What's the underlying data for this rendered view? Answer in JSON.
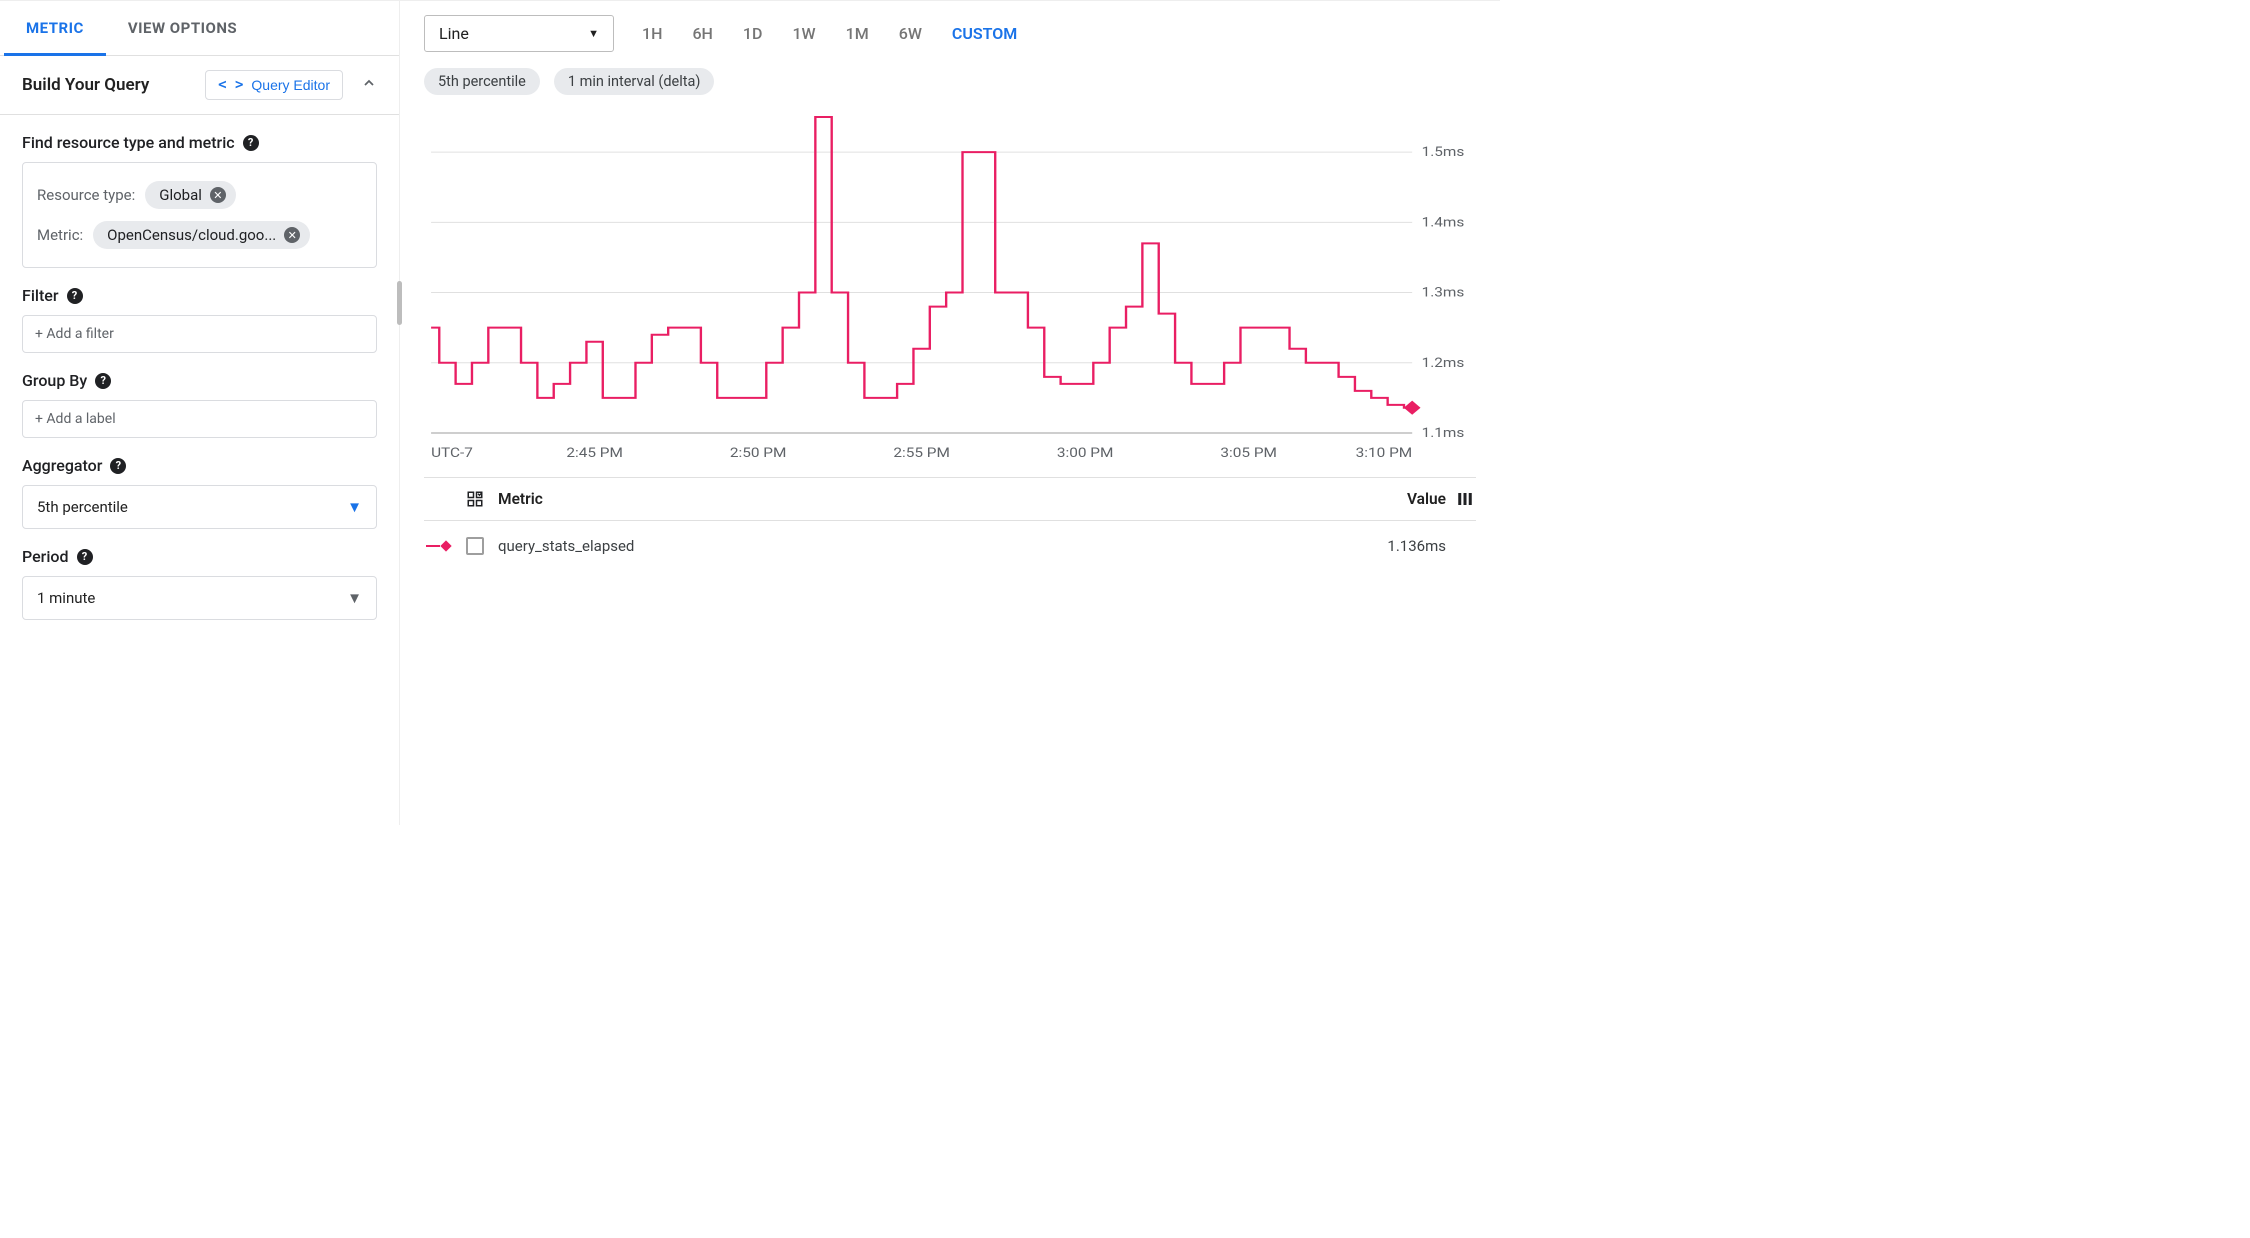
{
  "left": {
    "tabs": {
      "metric": "METRIC",
      "view_options": "VIEW OPTIONS"
    },
    "header": {
      "title": "Build Your Query",
      "query_editor": "Query Editor"
    },
    "find": {
      "label": "Find resource type and metric",
      "resource_type_key": "Resource type:",
      "resource_type_value": "Global",
      "metric_key": "Metric:",
      "metric_value": "OpenCensus/cloud.goo..."
    },
    "filter": {
      "label": "Filter",
      "placeholder": "+ Add a filter"
    },
    "group_by": {
      "label": "Group By",
      "placeholder": "+ Add a label"
    },
    "aggregator": {
      "label": "Aggregator",
      "value": "5th percentile"
    },
    "period": {
      "label": "Period",
      "value": "1 minute"
    }
  },
  "right": {
    "chart_type": "Line",
    "ranges": [
      "1H",
      "6H",
      "1D",
      "1W",
      "1M",
      "6W",
      "CUSTOM"
    ],
    "active_range": "CUSTOM",
    "pills": [
      "5th percentile",
      "1 min interval (delta)"
    ],
    "legend_header": {
      "metric": "Metric",
      "value": "Value"
    },
    "legend_row": {
      "name": "query_stats_elapsed",
      "value": "1.136ms"
    }
  },
  "chart_data": {
    "type": "line",
    "title": "",
    "xlabel": "UTC-7",
    "ylabel": "",
    "ylim": [
      1.1,
      1.55
    ],
    "x_ticks": [
      "UTC-7",
      "2:45 PM",
      "2:50 PM",
      "2:55 PM",
      "3:00 PM",
      "3:05 PM",
      "3:10 PM"
    ],
    "y_ticks": [
      "1.1ms",
      "1.2ms",
      "1.3ms",
      "1.4ms",
      "1.5ms"
    ],
    "series": [
      {
        "name": "query_stats_elapsed",
        "color": "#e91e63",
        "x": [
          0,
          1,
          2,
          3,
          4,
          5,
          6,
          7,
          8,
          9,
          10,
          11,
          12,
          13,
          14,
          15,
          16,
          17,
          18,
          19,
          20,
          21,
          22,
          23,
          24,
          25,
          26,
          27,
          28,
          29,
          30,
          31,
          32,
          33,
          34,
          35,
          36,
          37,
          38,
          39,
          40,
          41,
          42,
          43,
          44,
          45,
          46,
          47,
          48,
          49,
          50,
          51,
          52,
          53,
          54,
          55,
          56,
          57,
          58,
          59,
          60
        ],
        "values": [
          1.25,
          1.2,
          1.17,
          1.2,
          1.25,
          1.25,
          1.2,
          1.15,
          1.17,
          1.2,
          1.23,
          1.15,
          1.15,
          1.2,
          1.24,
          1.25,
          1.25,
          1.2,
          1.15,
          1.15,
          1.15,
          1.2,
          1.25,
          1.3,
          1.55,
          1.3,
          1.2,
          1.15,
          1.15,
          1.17,
          1.22,
          1.28,
          1.3,
          1.5,
          1.5,
          1.3,
          1.3,
          1.25,
          1.18,
          1.17,
          1.17,
          1.2,
          1.25,
          1.28,
          1.37,
          1.27,
          1.2,
          1.17,
          1.17,
          1.2,
          1.25,
          1.25,
          1.25,
          1.22,
          1.2,
          1.2,
          1.18,
          1.16,
          1.15,
          1.14,
          1.136
        ]
      }
    ]
  }
}
